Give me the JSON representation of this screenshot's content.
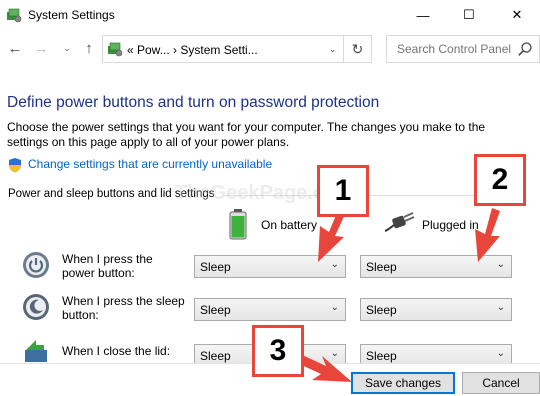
{
  "window": {
    "title": "System Settings",
    "minimize_glyph": "—",
    "maximize_glyph": "☐",
    "close_glyph": "✕"
  },
  "nav": {
    "back_glyph": "←",
    "forward_glyph": "→",
    "recent_glyph": "⌄",
    "up_glyph": "↑",
    "breadcrumb": "«   Pow...   ›   System Setti...",
    "dropdown_glyph": "⌄",
    "refresh_glyph": "↻",
    "search_placeholder": "Search Control Panel"
  },
  "main": {
    "heading": "Define power buttons and turn on password protection",
    "description": "Choose the power settings that you want for your computer. The changes you make to the settings on this page apply to all of your power plans.",
    "change_link": "Change settings that are currently unavailable",
    "group_label": "Power and sleep buttons and lid settings",
    "watermark": "TheGeekPage.com",
    "columns": {
      "battery": "On battery",
      "plugged": "Plugged in"
    },
    "rows": [
      {
        "label": "When I press the power button:",
        "battery": "Sleep",
        "plugged": "Sleep"
      },
      {
        "label": "When I press the sleep button:",
        "battery": "Sleep",
        "plugged": "Sleep"
      },
      {
        "label": "When I close the lid:",
        "battery": "Sleep",
        "plugged": "Sleep"
      }
    ]
  },
  "footer": {
    "save_label": "Save changes",
    "cancel_label": "Cancel"
  },
  "annotations": {
    "badge_1": "1",
    "badge_2": "2",
    "badge_3": "3",
    "accent_color": "#e8463a"
  },
  "colors": {
    "heading": "#1e3287",
    "link": "#0066cc",
    "focus_border": "#0078d7"
  },
  "icons": {
    "app": "control-panel-icon",
    "search": "search-icon",
    "shield": "shield-icon",
    "battery": "battery-icon",
    "plug": "plug-icon",
    "power": "power-button-icon",
    "sleep": "sleep-button-icon",
    "lid": "lid-icon"
  }
}
